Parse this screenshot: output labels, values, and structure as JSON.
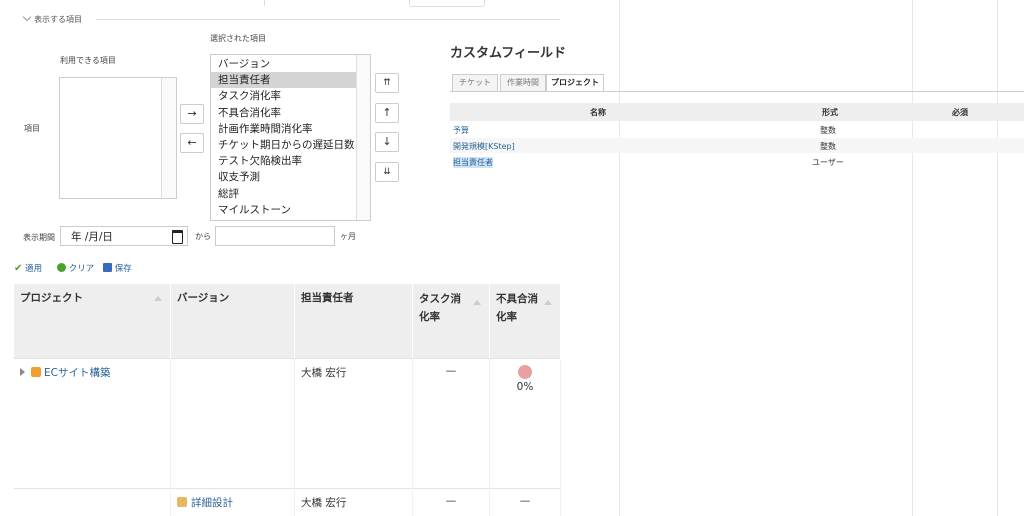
{
  "column_options": {
    "legend": "表示する項目",
    "available_label": "利用できる項目",
    "selected_label": "選択された項目",
    "row_label": "項目",
    "available_items": [],
    "selected_items": [
      "バージョン",
      "担当責任者",
      "タスク消化率",
      "不具合消化率",
      "計画作業時間消化率",
      "チケット期日からの遅延日数",
      "テスト欠陥検出率",
      "収支予測",
      "総評",
      "マイルストーン"
    ],
    "selected_highlight_index": 1,
    "move_right": "→",
    "move_left": "←",
    "move_top": "⇈",
    "move_up": "↑",
    "move_down": "↓",
    "move_bottom": "⇊"
  },
  "period": {
    "label": "表示期間",
    "date_value": "年 /月/日",
    "from_label": "から",
    "months_value": "",
    "unit_label": "ヶ月"
  },
  "actions": {
    "apply": "適用",
    "clear": "クリア",
    "save": "保存"
  },
  "grid": {
    "headers": [
      "プロジェクト",
      "バージョン",
      "担当責任者",
      "タスク消化率",
      "不具合消化率"
    ],
    "rows": [
      {
        "project": "ECサイト構築",
        "version": "",
        "manager": "大橋 宏行",
        "task_rate": "—",
        "bug_rate": "0%"
      },
      {
        "project": "",
        "version": "詳細設計",
        "manager": "大橋 宏行",
        "task_rate": "—",
        "bug_rate": "—"
      }
    ]
  },
  "custom_fields": {
    "title": "カスタムフィールド",
    "tabs": [
      "チケット",
      "作業時間",
      "プロジェクト"
    ],
    "active_tab": 2,
    "columns": [
      "名称",
      "形式",
      "必須"
    ],
    "rows": [
      {
        "name": "予算",
        "format": "整数"
      },
      {
        "name": "開発規模[KStep]",
        "format": "整数"
      },
      {
        "name": "担当責任者",
        "format": "ユーザー"
      }
    ]
  },
  "colors": {
    "link": "#2a6496",
    "apply_check": "#5a9a2a",
    "clear_icon": "#4aa02a",
    "save_icon": "#3a6ac0",
    "selected_bg": "#d4d4d4"
  }
}
